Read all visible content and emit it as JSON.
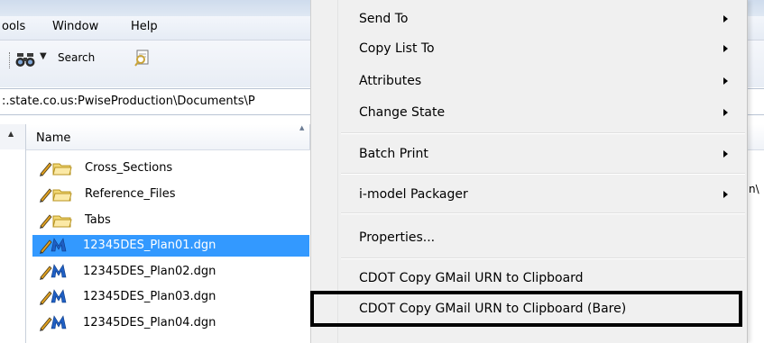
{
  "menubar": {
    "items": [
      "ools",
      "Window",
      "Help"
    ]
  },
  "toolbar": {
    "search_label": "Search",
    "icons": [
      "binoculars-icon",
      "dropdown-arrow-icon",
      "search-tool-icon"
    ]
  },
  "address": {
    "path": ":.state.co.us:PwiseProduction\\Documents\\P"
  },
  "right_fragments": {
    "toolbar_frag": "da",
    "address_frag": "n\\"
  },
  "file_list": {
    "column_name": "Name",
    "rows": [
      {
        "label": "Cross_Sections",
        "type": "folder",
        "selected": false
      },
      {
        "label": "Reference_Files",
        "type": "folder",
        "selected": false
      },
      {
        "label": "Tabs",
        "type": "folder",
        "selected": false
      },
      {
        "label": "12345DES_Plan01.dgn",
        "type": "dgn",
        "selected": true
      },
      {
        "label": "12345DES_Plan02.dgn",
        "type": "dgn",
        "selected": false
      },
      {
        "label": "12345DES_Plan03.dgn",
        "type": "dgn",
        "selected": false
      },
      {
        "label": "12345DES_Plan04.dgn",
        "type": "dgn",
        "selected": false
      }
    ]
  },
  "context_menu": {
    "items": [
      {
        "label": "Send To",
        "submenu": true
      },
      {
        "label": "Copy List To",
        "submenu": true
      },
      {
        "label": "Attributes",
        "submenu": true
      },
      {
        "label": "Change State",
        "submenu": true
      },
      {
        "label": "Batch Print",
        "submenu": true
      },
      {
        "label": "i-model Packager",
        "submenu": true
      },
      {
        "label": "Properties...",
        "submenu": false
      },
      {
        "label": "CDOT Copy GMail URN to Clipboard",
        "submenu": false
      },
      {
        "label": "CDOT Copy GMail URN to Clipboard (Bare)",
        "submenu": false,
        "highlighted_by_callout": true
      }
    ]
  },
  "colors": {
    "selection": "#3399ff",
    "menu_background": "#f0f0f0",
    "callout_border": "#000000"
  }
}
